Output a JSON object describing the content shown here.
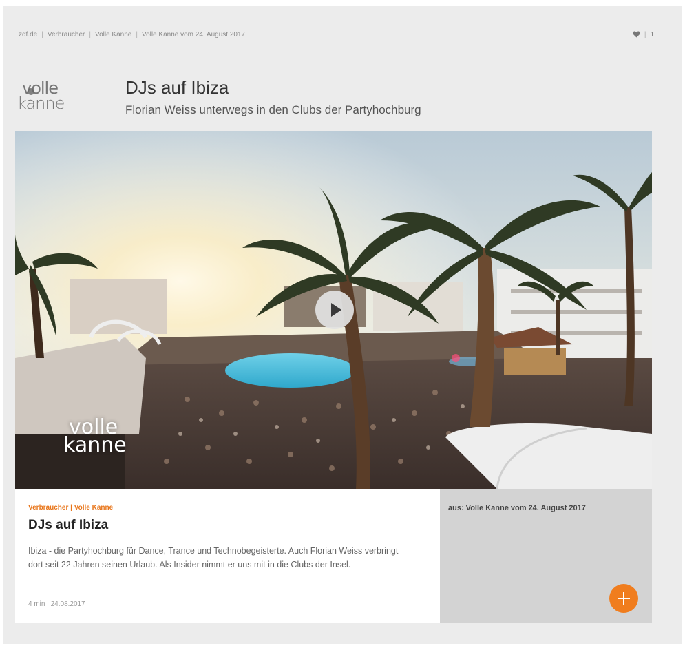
{
  "breadcrumb": [
    "zdf.de",
    "Verbraucher",
    "Volle Kanne",
    "Volle Kanne vom 24. August 2017"
  ],
  "likes": {
    "count": "1"
  },
  "logo": {
    "line1": "volle",
    "line2": "kanne"
  },
  "header": {
    "title": "DJs auf Ibiza",
    "subtitle": "Florian Weiss unterwegs in den Clubs der Partyhochburg"
  },
  "video": {
    "watermark_line1": "volle",
    "watermark_line2": "kanne"
  },
  "info": {
    "category": "Verbraucher | Volle Kanne",
    "title": "DJs auf Ibiza",
    "description": "Ibiza - die Partyhochburg für Dance, Trance und Technobegeisterte. Auch Florian Weiss verbringt dort seit 22 Jahren seinen Urlaub. Als Insider nimmt er uns mit in die Clubs der Insel.",
    "meta": "4 min | 24.08.2017"
  },
  "side": {
    "from": "aus: Volle Kanne vom 24. August 2017"
  },
  "colors": {
    "accent": "#f07d1e",
    "category": "#e8751a"
  }
}
